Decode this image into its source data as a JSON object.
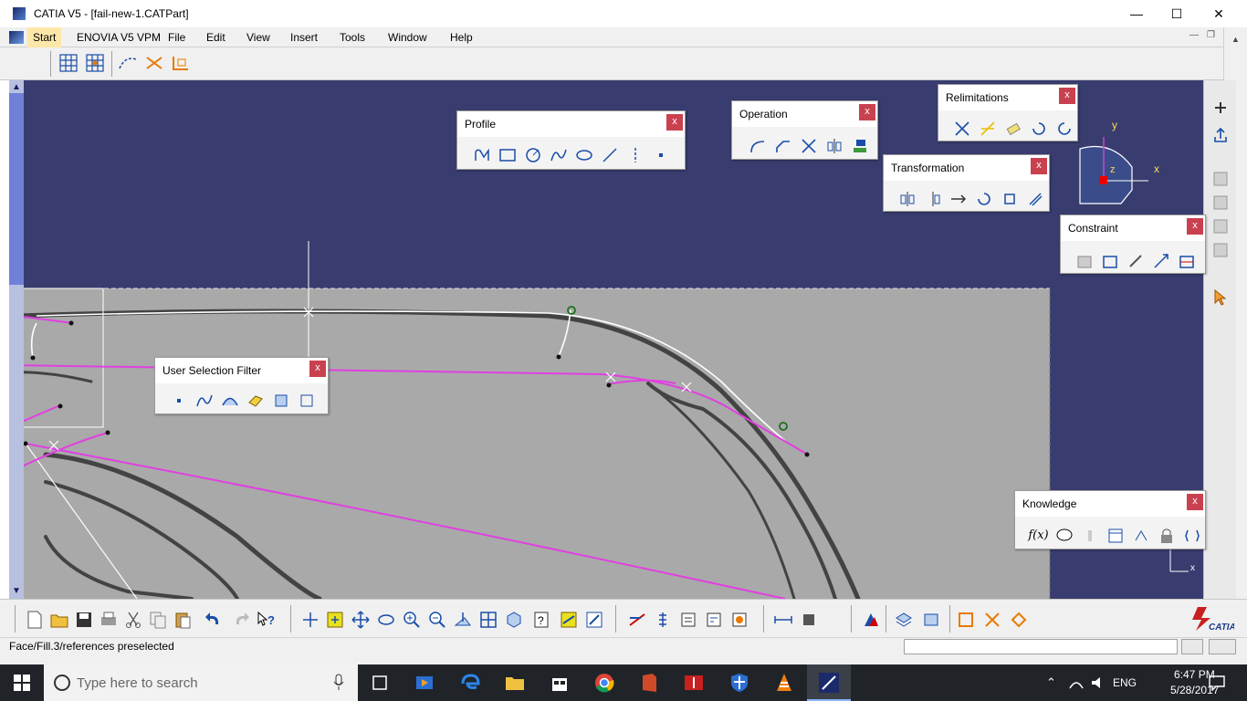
{
  "window": {
    "title": "CATIA V5 - [fail-new-1.CATPart]",
    "minimize": "—",
    "maximize": "☐",
    "close": "✕"
  },
  "menu": {
    "items": [
      "Start",
      "ENOVIA V5 VPM",
      "File",
      "Edit",
      "View",
      "Insert",
      "Tools",
      "Window",
      "Help"
    ],
    "mdi_min": "—",
    "mdi_restore": "❐",
    "mdi_close": "✕"
  },
  "palettes": {
    "profile": {
      "title": "Profile",
      "close": "x"
    },
    "operation": {
      "title": "Operation",
      "close": "x"
    },
    "relimitations": {
      "title": "Relimitations",
      "close": "x"
    },
    "transformation": {
      "title": "Transformation",
      "close": "x"
    },
    "constraint": {
      "title": "Constraint",
      "close": "x"
    },
    "user_selection_filter": {
      "title": "User Selection Filter",
      "close": "x"
    },
    "knowledge": {
      "title": "Knowledge",
      "close": "x"
    }
  },
  "axis": {
    "x": "x",
    "y": "y",
    "z": "z"
  },
  "corner_axis": {
    "x": "x"
  },
  "status": {
    "text": "Face/Fill.3/references preselected"
  },
  "taskbar": {
    "search_placeholder": "Type here to search",
    "lang": "ENG",
    "time": "6:47 PM",
    "date": "5/28/2017"
  },
  "colors": {
    "viewport_bg": "#383c6e",
    "curve_magenta": "#e040e0",
    "close_red": "#c9414f"
  }
}
